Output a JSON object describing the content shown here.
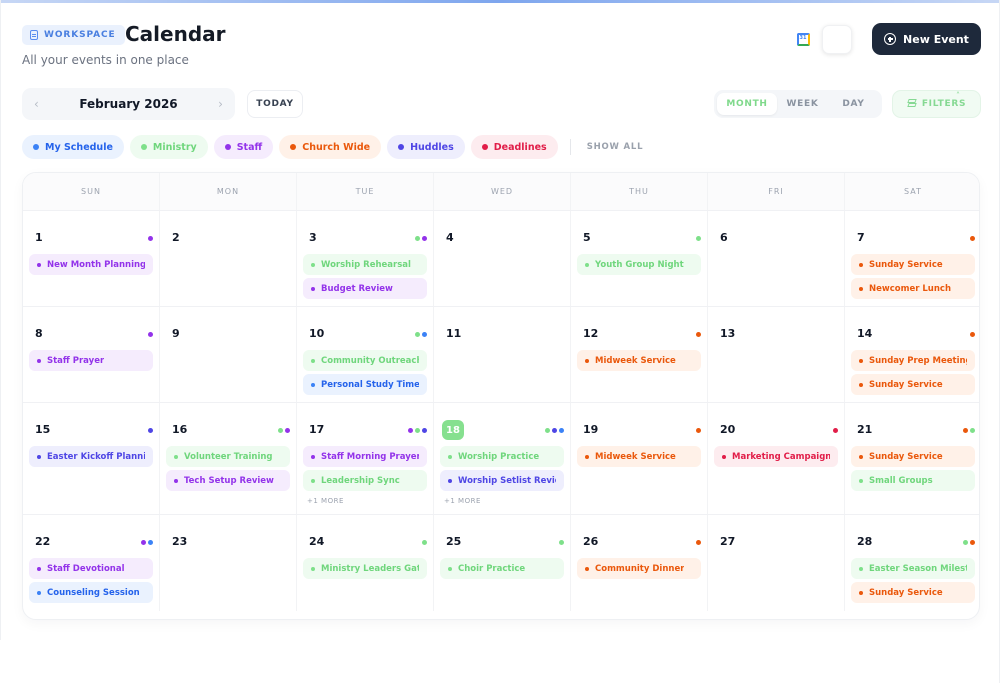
{
  "header": {
    "badge": "WORKSPACE",
    "title": "Calendar",
    "subtitle": "All your events in one place",
    "new_event_label": "New Event"
  },
  "nav": {
    "prev_arrow": "‹",
    "next_arrow": "›",
    "month_label": "February 2026",
    "today_label": "TODAY"
  },
  "views": {
    "month": "MONTH",
    "week": "WEEK",
    "day": "DAY",
    "active": "month"
  },
  "filters": {
    "label": "FILTERS",
    "caret": "˄"
  },
  "categories": [
    {
      "key": "schedule",
      "label": "My Schedule",
      "color": "#3b82f6",
      "bg": "#eaf2fe",
      "fg": "#2563eb"
    },
    {
      "key": "ministry",
      "label": "Ministry",
      "color": "#7ee08a",
      "bg": "#eefbf0",
      "fg": "#6fd67c"
    },
    {
      "key": "staff",
      "label": "Staff",
      "color": "#9333ea",
      "bg": "#f5ecfd",
      "fg": "#9333ea"
    },
    {
      "key": "church",
      "label": "Church Wide",
      "color": "#ea580c",
      "bg": "#fff1e8",
      "fg": "#ea580c"
    },
    {
      "key": "huddles",
      "label": "Huddles",
      "color": "#4f46e5",
      "bg": "#eeeefd",
      "fg": "#4f46e5"
    },
    {
      "key": "deadlines",
      "label": "Deadlines",
      "color": "#e11d48",
      "bg": "#fdecef",
      "fg": "#e11d48"
    }
  ],
  "show_all_label": "SHOW ALL",
  "weekdays": [
    "SUN",
    "MON",
    "TUE",
    "WED",
    "THU",
    "FRI",
    "SAT"
  ],
  "weeks": [
    {
      "days": [
        {
          "num": "1",
          "dots": [
            "staff"
          ],
          "events": [
            {
              "label": "New Month Planning",
              "cat": "staff"
            }
          ]
        },
        {
          "num": "2",
          "dots": [],
          "events": []
        },
        {
          "num": "3",
          "dots": [
            "ministry",
            "staff"
          ],
          "events": [
            {
              "label": "Worship Rehearsal",
              "cat": "ministry"
            },
            {
              "label": "Budget Review",
              "cat": "staff"
            }
          ]
        },
        {
          "num": "4",
          "dots": [],
          "events": []
        },
        {
          "num": "5",
          "dots": [
            "ministry"
          ],
          "events": [
            {
              "label": "Youth Group Night",
              "cat": "ministry"
            }
          ]
        },
        {
          "num": "6",
          "dots": [],
          "events": []
        },
        {
          "num": "7",
          "dots": [
            "church"
          ],
          "events": [
            {
              "label": "Sunday Service",
              "cat": "church"
            },
            {
              "label": "Newcomer Lunch",
              "cat": "church"
            }
          ]
        }
      ]
    },
    {
      "days": [
        {
          "num": "8",
          "dots": [
            "staff"
          ],
          "events": [
            {
              "label": "Staff Prayer",
              "cat": "staff"
            }
          ]
        },
        {
          "num": "9",
          "dots": [],
          "events": []
        },
        {
          "num": "10",
          "dots": [
            "ministry",
            "schedule"
          ],
          "events": [
            {
              "label": "Community Outreach P",
              "cat": "ministry"
            },
            {
              "label": "Personal Study Time",
              "cat": "schedule"
            }
          ]
        },
        {
          "num": "11",
          "dots": [],
          "events": []
        },
        {
          "num": "12",
          "dots": [
            "church"
          ],
          "events": [
            {
              "label": "Midweek Service",
              "cat": "church"
            }
          ]
        },
        {
          "num": "13",
          "dots": [],
          "events": []
        },
        {
          "num": "14",
          "dots": [
            "church"
          ],
          "events": [
            {
              "label": "Sunday Prep Meeting",
              "cat": "church"
            },
            {
              "label": "Sunday Service",
              "cat": "church"
            }
          ]
        }
      ]
    },
    {
      "days": [
        {
          "num": "15",
          "dots": [
            "huddles"
          ],
          "events": [
            {
              "label": "Easter Kickoff Planning",
              "cat": "huddles"
            }
          ]
        },
        {
          "num": "16",
          "dots": [
            "ministry",
            "staff"
          ],
          "events": [
            {
              "label": "Volunteer Training",
              "cat": "ministry"
            },
            {
              "label": "Tech Setup Review",
              "cat": "staff"
            }
          ]
        },
        {
          "num": "17",
          "dots": [
            "staff",
            "ministry",
            "huddles"
          ],
          "events": [
            {
              "label": "Staff Morning Prayer",
              "cat": "staff"
            },
            {
              "label": "Leadership Sync",
              "cat": "ministry"
            }
          ],
          "more": "+1 MORE"
        },
        {
          "num": "18",
          "today": true,
          "dots": [
            "ministry",
            "huddles",
            "schedule"
          ],
          "events": [
            {
              "label": "Worship Practice",
              "cat": "ministry"
            },
            {
              "label": "Worship Setlist Review",
              "cat": "huddles"
            }
          ],
          "more": "+1 MORE"
        },
        {
          "num": "19",
          "dots": [
            "church"
          ],
          "events": [
            {
              "label": "Midweek Service",
              "cat": "church"
            }
          ]
        },
        {
          "num": "20",
          "dots": [
            "deadlines"
          ],
          "events": [
            {
              "label": "Marketing Campaign D",
              "cat": "deadlines"
            }
          ]
        },
        {
          "num": "21",
          "dots": [
            "church",
            "ministry"
          ],
          "events": [
            {
              "label": "Sunday Service",
              "cat": "church"
            },
            {
              "label": "Small Groups",
              "cat": "ministry"
            }
          ]
        }
      ]
    },
    {
      "days": [
        {
          "num": "22",
          "dots": [
            "staff",
            "schedule"
          ],
          "events": [
            {
              "label": "Staff Devotional",
              "cat": "staff"
            },
            {
              "label": "Counseling Session",
              "cat": "schedule"
            }
          ]
        },
        {
          "num": "23",
          "dots": [],
          "events": []
        },
        {
          "num": "24",
          "dots": [
            "ministry"
          ],
          "events": [
            {
              "label": "Ministry Leaders Gather",
              "cat": "ministry"
            }
          ]
        },
        {
          "num": "25",
          "dots": [
            "ministry"
          ],
          "events": [
            {
              "label": "Choir Practice",
              "cat": "ministry"
            }
          ]
        },
        {
          "num": "26",
          "dots": [
            "church"
          ],
          "events": [
            {
              "label": "Community Dinner",
              "cat": "church"
            }
          ]
        },
        {
          "num": "27",
          "dots": [],
          "events": []
        },
        {
          "num": "28",
          "dots": [
            "ministry",
            "church"
          ],
          "events": [
            {
              "label": "Easter Season Milestone",
              "cat": "ministry"
            },
            {
              "label": "Sunday Service",
              "cat": "church"
            }
          ]
        }
      ]
    }
  ]
}
